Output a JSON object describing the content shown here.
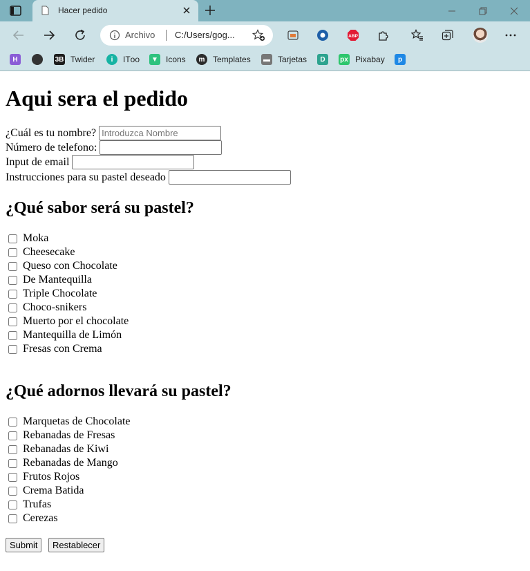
{
  "browser": {
    "tab_title": "Hacer pedido",
    "address_label": "Archivo",
    "address_url": "C:/Users/gog...",
    "bookmarks": [
      {
        "label": "",
        "icon": "h-bookmark-icon",
        "color": "#8a5cd6",
        "glyph": "H"
      },
      {
        "label": "",
        "icon": "github-icon",
        "color": "#333333",
        "glyph": ""
      },
      {
        "label": "Twider",
        "icon": "twider-icon",
        "color": "#1d1d1d",
        "glyph": "3B"
      },
      {
        "label": "ITоо",
        "icon": "itoo-icon",
        "color": "#17b3a3",
        "glyph": "i"
      },
      {
        "label": "Icons",
        "icon": "icons-icon",
        "color": "#2ec27e",
        "glyph": "▼"
      },
      {
        "label": "Templates",
        "icon": "templates-icon",
        "color": "#2b2b2b",
        "glyph": "m"
      },
      {
        "label": "Tarjetas",
        "icon": "tarjetas-icon",
        "color": "#777777",
        "glyph": "▬"
      },
      {
        "label": "",
        "icon": "d-bookmark-icon",
        "color": "#2da38f",
        "glyph": "D"
      },
      {
        "label": "Pixabay",
        "icon": "pixabay-icon",
        "color": "#2ec66d",
        "glyph": "px"
      },
      {
        "label": "",
        "icon": "p-bookmark-icon",
        "color": "#1e88e5",
        "glyph": "p"
      }
    ]
  },
  "page": {
    "heading": "Aqui sera el pedido",
    "fields": [
      {
        "label": "¿Cuál es tu nombre?",
        "placeholder": "Introduzca Nombre",
        "value": ""
      },
      {
        "label": "Número de telefono:",
        "placeholder": "",
        "value": ""
      },
      {
        "label": "Input de email",
        "placeholder": "",
        "value": ""
      },
      {
        "label": "Instrucciones para su pastel deseado",
        "placeholder": "",
        "value": ""
      }
    ],
    "flavors_heading": "¿Qué sabor será su pastel?",
    "flavors": [
      "Moka",
      "Cheesecake",
      "Queso con Chocolate",
      "De Mantequilla",
      "Triple Chocolate",
      "Choco-snikers",
      "Muerto por el chocolate",
      "Mantequilla de Limón",
      "Fresas con Crema"
    ],
    "toppings_heading": "¿Qué adornos llevará su pastel?",
    "toppings": [
      "Marquetas de Chocolate",
      "Rebanadas de Fresas",
      "Rebanadas de Kiwi",
      "Rebanadas de Mango",
      "Frutos Rojos",
      "Crema Batida",
      "Trufas",
      "Cerezas"
    ],
    "submit_label": "Submit",
    "reset_label": "Restablecer"
  }
}
